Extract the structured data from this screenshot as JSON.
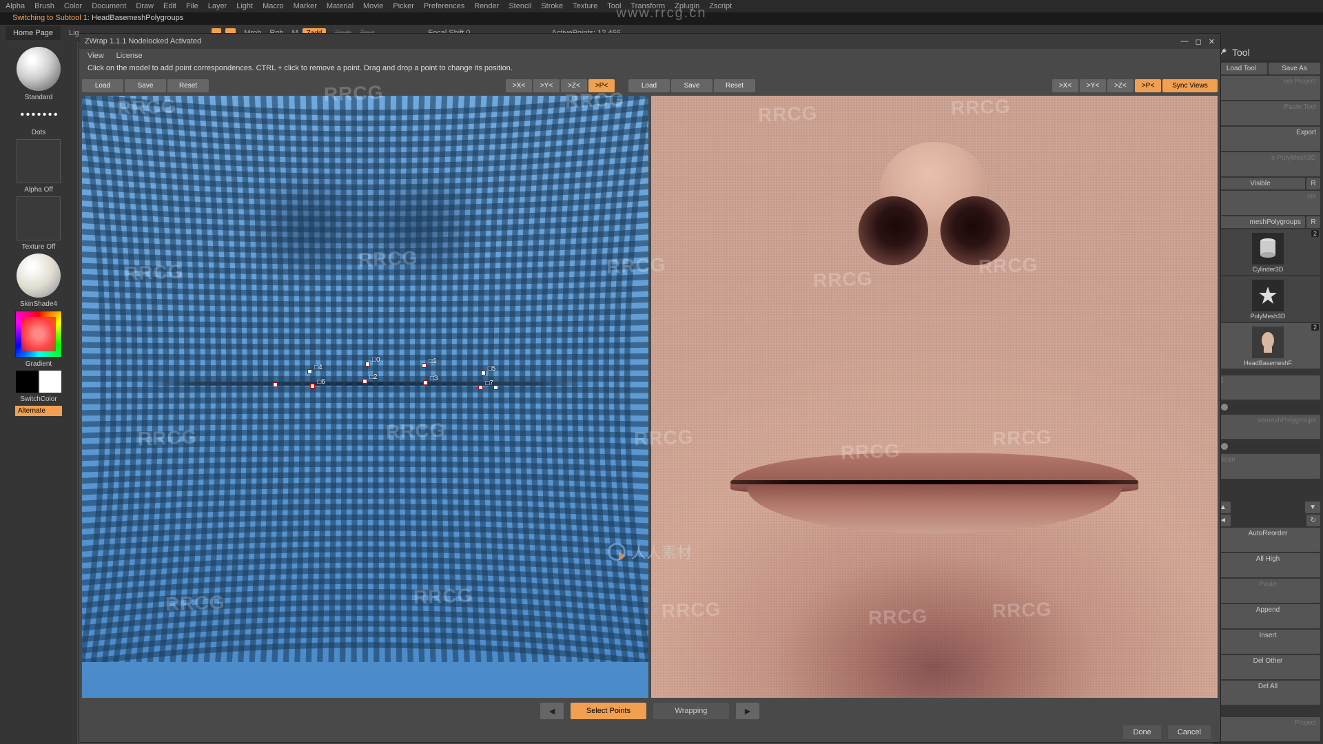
{
  "menubar": [
    "Alpha",
    "Brush",
    "Color",
    "Document",
    "Draw",
    "Edit",
    "File",
    "Layer",
    "Light",
    "Macro",
    "Marker",
    "Material",
    "Movie",
    "Picker",
    "Preferences",
    "Render",
    "Stencil",
    "Stroke",
    "Texture",
    "Tool",
    "Transform",
    "Zplugin",
    "Zscript"
  ],
  "status": {
    "prefix": "Switching to Subtool 1:",
    "name": "HeadBasemeshPolygroups"
  },
  "toolbar": {
    "home": "Home Page",
    "lig": "Lig",
    "mrph": "Mrph",
    "rgb": "Rgb",
    "m": "M",
    "zadd": "Zadd",
    "zsub": "Zsub",
    "zcut": "Zcut",
    "focal": "Focal Shift 0",
    "active": "ActivePoints: 12,466"
  },
  "left": {
    "brush": "Standard",
    "stroke": "Dots",
    "alpha": "Alpha Off",
    "texture": "Texture Off",
    "material": "SkinShade4",
    "gradient": "Gradient",
    "switch": "SwitchColor",
    "alternate": "Alternate"
  },
  "right": {
    "title": "Tool",
    "load": "Load Tool",
    "saveas": "Save As",
    "proj": "om Project",
    "paste": "Paste Tool",
    "export": "Export",
    "polymesh": "e PolyMesh3D",
    "visible": "Visible",
    "r": "R",
    "ols": "ols",
    "meshpoly": "meshPolygroups",
    "cyl": "Cylinder3D",
    "poly": "PolyMesh3D",
    "head": "HeadBasemeshF",
    "count1": "2",
    "count2": "2",
    "six": "6",
    "semesh": "semeshPolygroups",
    "scan": "Scan",
    "autoreorder": "AutoReorder",
    "allhigh": "All High",
    "pasteBtn": "Paste",
    "append": "Append",
    "insert": "Insert",
    "delother": "Del Other",
    "delall": "Del All",
    "project": "Project"
  },
  "zwrap": {
    "title": "ZWrap 1.1.1 Nodelocked Activated",
    "menu": [
      "View",
      "License"
    ],
    "hint": "Click on the model to add point correspondences. CTRL + click to remove a point. Drag and drop a point to change its position.",
    "btns": {
      "load": "Load",
      "save": "Save",
      "reset": "Reset",
      "xc": ">X<",
      "yc": ">Y<",
      "zc": ">Z<",
      "pc": ">P<",
      "sync": "Sync Views"
    },
    "steps": {
      "select": "Select Points",
      "wrap": "Wrapping"
    },
    "done": "Done",
    "cancel": "Cancel",
    "points": [
      {
        "n": "0",
        "x": 50,
        "y": 44.2
      },
      {
        "n": "1",
        "x": 60.0,
        "y": 44.4
      },
      {
        "n": "2",
        "x": 49.5,
        "y": 47.0
      },
      {
        "n": "3",
        "x": 60.2,
        "y": 47.2
      },
      {
        "n": "4",
        "x": 39.8,
        "y": 45.4
      },
      {
        "n": "5",
        "x": 70.4,
        "y": 45.7
      },
      {
        "n": "6",
        "x": 40.3,
        "y": 47.8
      },
      {
        "n": "7",
        "x": 70.0,
        "y": 48.0
      },
      {
        "n": "",
        "x": 33.7,
        "y": 47.6
      },
      {
        "n": "",
        "x": 72.6,
        "y": 48.1
      }
    ]
  },
  "watermarks": {
    "rrcg": "RRCG",
    "url": "www.rrcg.cn",
    "logo": "人人素材"
  }
}
